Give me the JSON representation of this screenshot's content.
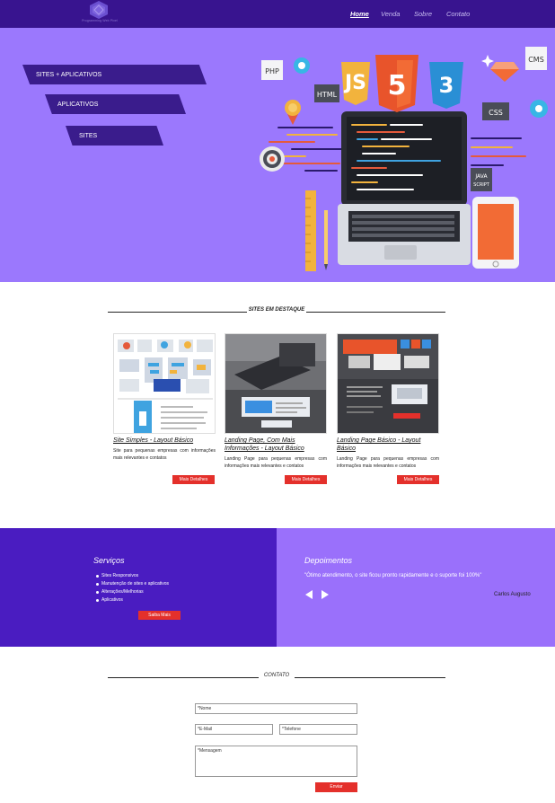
{
  "header": {
    "logo_text": "Programming Web Pixel",
    "nav": [
      {
        "label": "Home",
        "active": true
      },
      {
        "label": "Venda"
      },
      {
        "label": "Sobre"
      },
      {
        "label": "Contato"
      }
    ]
  },
  "hero": {
    "banners": [
      "SITES + APLICATIVOS",
      "APLICATIVOS",
      "SITES"
    ],
    "art_labels": {
      "php": "PHP",
      "html": "HTML",
      "js": "JS",
      "css": "CSS",
      "cms": "CMS",
      "java": "JAVA",
      "script": "SCRIPT"
    }
  },
  "featured": {
    "title": "SITES EM DESTAQUE",
    "cards": [
      {
        "title": "Site Simples - Layout Básico",
        "desc": "Site para pequenas empresas com informações mais relevantes e contatos",
        "button": "Mais Detalhes"
      },
      {
        "title": "Landing Page, Com Mais Informações - Layout Básico",
        "desc": "Landing Page para pequenas empresas com informações mais relevantes e contatos",
        "button": "Mais Detalhes"
      },
      {
        "title": "Landing Page Básico - Layout Básico",
        "desc": "Landing Page para pequenas empresas com informações mais relevantes e contatos",
        "button": "Mais Detalhes"
      }
    ]
  },
  "services": {
    "title": "Serviços",
    "items": [
      "Sites Responsivos",
      "Manutenção de sites e aplicativos",
      "Alterações/Melhorias",
      "Aplicativos"
    ],
    "button": "Saiba Mais"
  },
  "testimonials": {
    "title": "Depoimentos",
    "quote": "\"Ótimo atendimento, o site ficou pronto rapidamente e o suporte foi 100%\"",
    "author": "Carlos Augusto"
  },
  "contact": {
    "title": "CONTATO",
    "name_placeholder": "*Nome",
    "email_placeholder": "*E-Mail",
    "phone_placeholder": "*Telefone",
    "message_placeholder": "*Mensagem",
    "submit": "Enviar"
  },
  "colors": {
    "header_bg": "#38148f",
    "hero_bg": "#9b78fd",
    "banner_bg": "#3a1c8c",
    "services_bg": "#4a1cc1",
    "testimonials_bg": "#9a70fb",
    "accent_red": "#e4302b"
  }
}
